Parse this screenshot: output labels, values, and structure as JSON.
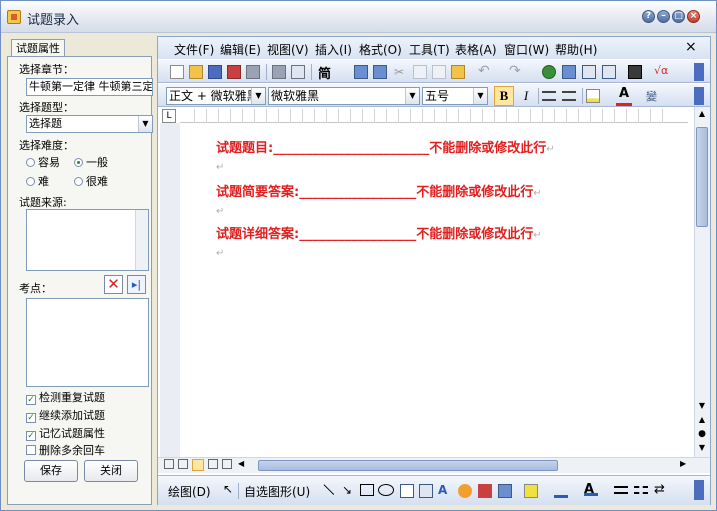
{
  "window": {
    "title": "试题录入"
  },
  "title_buttons": [
    "?",
    "–",
    "□",
    "×"
  ],
  "left": {
    "tab": "试题属性",
    "chapter_label": "选择章节：",
    "chapter_value": "牛顿第一定律 牛顿第三定律",
    "type_label": "选择题型：",
    "type_value": "选择题",
    "difficulty_label": "选择难度：",
    "difficulties": [
      {
        "label": "容易",
        "checked": false
      },
      {
        "label": "一般",
        "checked": true
      },
      {
        "label": "难",
        "checked": false
      },
      {
        "label": "很难",
        "checked": false
      }
    ],
    "source_label": "试题来源:",
    "points_label": "考点：",
    "checks": [
      {
        "label": "检测重复试题",
        "checked": true
      },
      {
        "label": "继续添加试题",
        "checked": true
      },
      {
        "label": "记忆试题属性",
        "checked": true
      },
      {
        "label": "删除多余回车",
        "checked": false
      }
    ],
    "save": "保存",
    "close": "关闭"
  },
  "menu": [
    "文件(F)",
    "编辑(E)",
    "视图(V)",
    "插入(I)",
    "格式(O)",
    "工具(T)",
    "表格(A)",
    "窗口(W)",
    "帮助(H)"
  ],
  "menu_close": "×",
  "toolbar": {
    "jian": "简"
  },
  "format": {
    "style": "正文 + 微软雅黑",
    "font": "微软雅黑",
    "size": "五号",
    "bold": "B",
    "italic": "I",
    "font_color": "A"
  },
  "doc": {
    "lines": [
      "试题题目:________________________不能删除或修改此行",
      "试题简要答案:__________________不能删除或修改此行",
      "试题详细答案:__________________不能删除或修改此行"
    ],
    "para_mark": "↵"
  },
  "draw": {
    "draw_label": "绘图(D)",
    "shapes_label": "自选图形(U)"
  },
  "colors": {
    "accent_red": "#e32020",
    "frame": "#8da6cc"
  }
}
